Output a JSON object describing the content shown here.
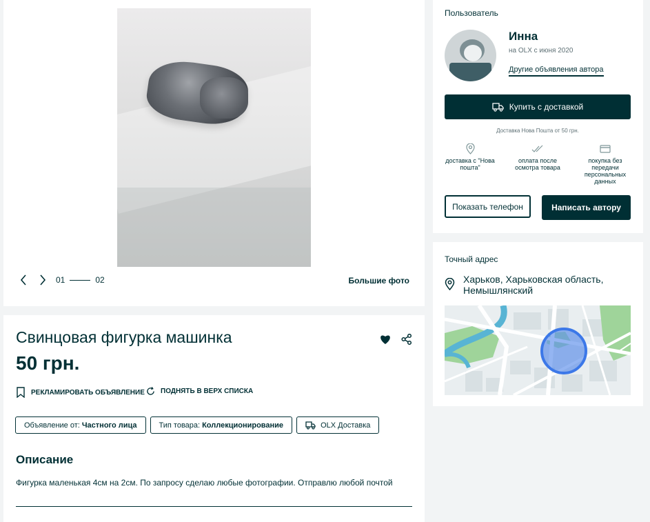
{
  "gallery": {
    "counter_current": "01",
    "counter_total": "02",
    "big_photo_label": "Большие фото",
    "photo_alt": "Свинцовая фигурка машинка"
  },
  "listing": {
    "title": "Свинцовая фигурка машинка",
    "price": "50 грн.",
    "actions": {
      "promote": "РЕКЛАМИРОВАТЬ ОБЪЯВЛЕНИЕ",
      "raise": "ПОДНЯТЬ В ВЕРХ СПИСКА"
    },
    "tags": [
      {
        "label": "Объявление от:",
        "value": "Частного лица"
      },
      {
        "label": "Тип товара:",
        "value": "Коллекционирование"
      },
      {
        "label": "OLX Доставка",
        "value": ""
      }
    ],
    "description_heading": "Описание",
    "description": "Фигурка маленькая 4см на 2см. По запросу сделаю любые фотографии. Отправлю любой почтой"
  },
  "seller": {
    "heading": "Пользователь",
    "name": "Инна",
    "since": "на OLX с июня 2020",
    "other_ads": "Другие объявления автора",
    "buy_button": "Купить с доставкой",
    "delivery_note": "Доставка Нова Пошта от 50 грн.",
    "features": [
      {
        "icon": "location-pin-icon",
        "text": "доставка с \"Нова пошта\""
      },
      {
        "icon": "double-check-icon",
        "text": "оплата после осмотра товара"
      },
      {
        "icon": "credit-card-icon",
        "text": "покупка без передачи персональных данных"
      }
    ],
    "show_phone": "Показать телефон",
    "write_author": "Написать автору"
  },
  "address": {
    "heading": "Точный адрес",
    "location": "Харьков, Харьковская область, Немышлянский"
  },
  "colors": {
    "primary": "#002f34",
    "background": "#f2f4f5",
    "map_green": "#9fd49a",
    "map_water": "#58b4d4",
    "map_marker": "#3c78e8"
  }
}
